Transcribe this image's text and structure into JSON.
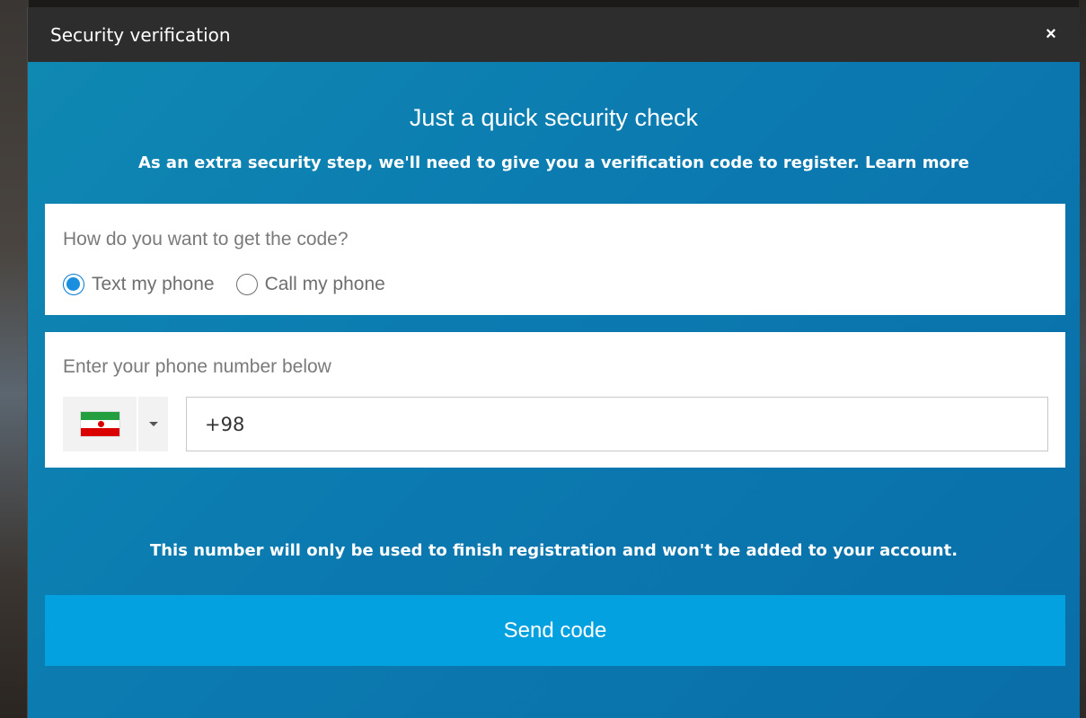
{
  "dialog": {
    "title": "Security verification",
    "close_symbol": "×",
    "heading": "Just a quick security check",
    "subtitle": "As an extra security step, we'll need to give you a verification code to register.",
    "learn_more": "Learn more"
  },
  "method": {
    "label": "How do you want to get the code?",
    "options": [
      {
        "label": "Text my phone",
        "checked": true
      },
      {
        "label": "Call my phone",
        "checked": false
      }
    ]
  },
  "phone": {
    "label": "Enter your phone number below",
    "country_flag_icon": "iran-flag-icon",
    "dropdown_icon": "caret-down-icon",
    "value": "+98"
  },
  "note": "This number will only be used to finish registration and won't be added to your account.",
  "send_button": "Send code",
  "colors": {
    "titlebar": "#2d2d2d",
    "body_bg": "#0b7ab0",
    "button": "#03a1e0",
    "radio_checked": "#1a8fe0"
  }
}
